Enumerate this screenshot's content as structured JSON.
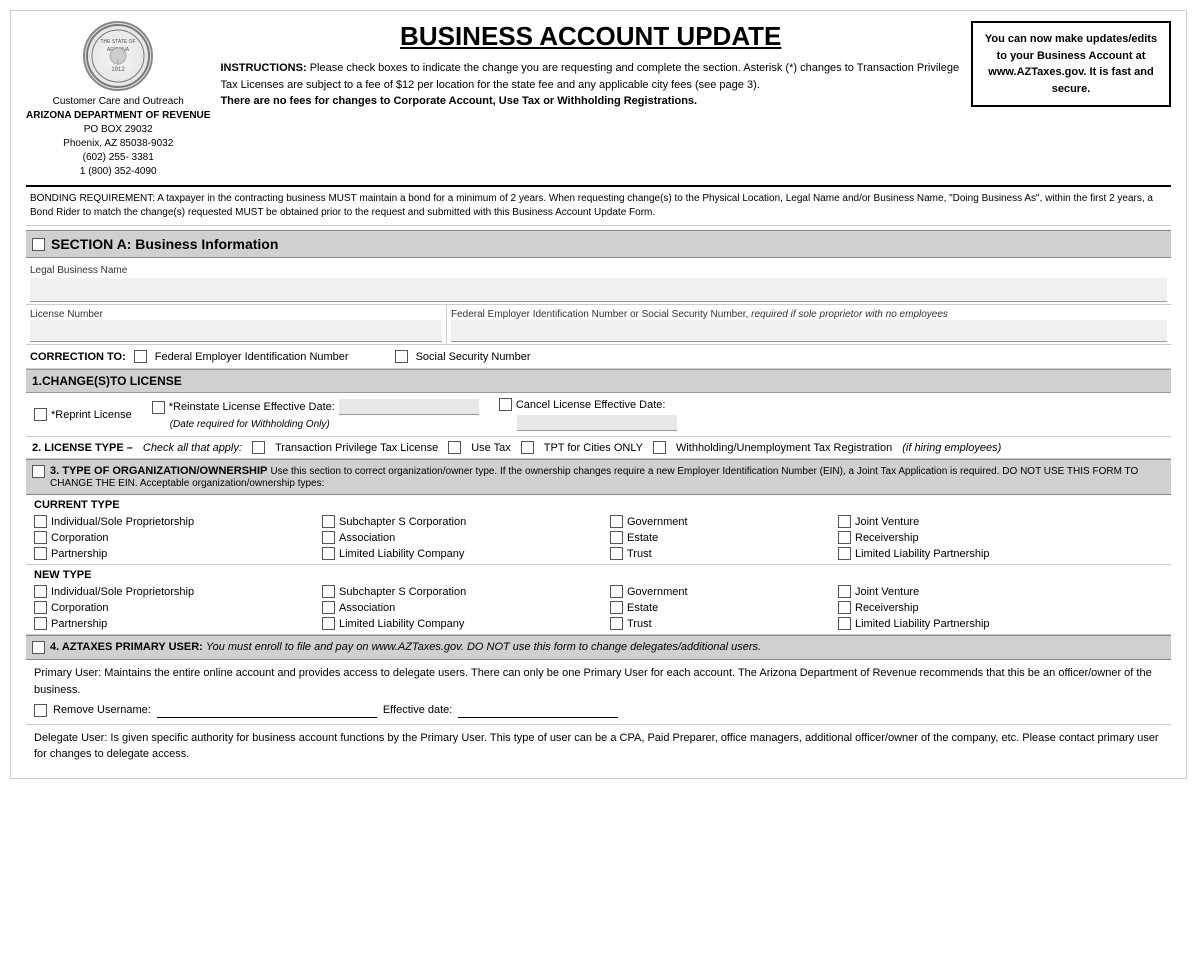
{
  "page": {
    "title": "BUSINESS ACCOUNT UPDATE",
    "seal_text": "THE STATE OF ARIZONA 1912",
    "dept": {
      "line1": "Customer Care and Outreach",
      "line2": "ARIZONA DEPARTMENT OF REVENUE",
      "line3": "PO BOX 29032",
      "line4": "Phoenix, AZ  85038-9032",
      "line5": "(602) 255- 3381",
      "line6": "1 (800) 352-4090"
    },
    "instructions": {
      "text1": "INSTRUCTIONS: ",
      "text2": "Please check boxes to indicate the change you are requesting and complete the section.  Asterisk (*) changes to Transaction Privilege Tax Licenses are subject to a fee of $12 per location for the state fee and any applicable city fees (see page 3).",
      "bold_text": "There are no fees for changes to Corporate Account, Use Tax or Withholding Registrations."
    },
    "sidebar": {
      "text": "You can now make updates/edits to your Business Account at www.AZTaxes.gov. It is fast and secure."
    },
    "bonding": {
      "text": "BONDING REQUIREMENT: A taxpayer in the contracting business MUST maintain a bond for a minimum of 2 years. When requesting change(s) to the Physical Location, Legal Name and/or Business Name, \"Doing Business As\",  within the first 2 years, a Bond Rider to match the change(s) requested MUST be obtained prior to the request and submitted with this Business Account Update Form."
    },
    "sectionA": {
      "title": "SECTION A:  Business Information",
      "legal_name_label": "Legal Business Name",
      "license_number_label": "License Number",
      "fein_label": "Federal Employer Identification Number or Social Security Number",
      "fein_note": "required if sole proprietor with no employees",
      "correction_label": "CORRECTION TO:",
      "correction_fein": "Federal Employer Identification Number",
      "correction_ssn": "Social Security Number"
    },
    "section1": {
      "title": "1.CHANGE(S)TO LICENSE",
      "reprint_label": "*Reprint License",
      "reinstate_label": "*Reinstate License Effective Date:",
      "cancel_label": "Cancel License Effective Date:",
      "date_required_note": "(Date required for Withholding Only)"
    },
    "section2": {
      "title": "2. LICENSE TYPE –",
      "subtitle": "Check all that apply:",
      "options": [
        "Transaction Privilege Tax License",
        "Use Tax",
        "TPT for Cities ONLY",
        "Withholding/Unemployment Tax Registration",
        "if hiring employees"
      ]
    },
    "section3": {
      "title": "3. TYPE OF ORGANIZATION/OWNERSHIP",
      "description": "Use this section to correct organization/owner type. If the ownership changes require a new Employer Identification Number (EIN), a Joint Tax Application is required. DO NOT USE THIS FORM TO CHANGE THE EIN. Acceptable organization/ownership types:",
      "current_type_label": "CURRENT TYPE",
      "new_type_label": "NEW TYPE",
      "org_types": {
        "col1": [
          "Individual/Sole Proprietorship",
          "Corporation",
          "Partnership"
        ],
        "col2": [
          "Subchapter S Corporation",
          "Association",
          "Limited Liability Company"
        ],
        "col3": [
          "Government",
          "Estate",
          "Trust"
        ],
        "col4": [
          "Joint Venture",
          "Receivership",
          "Limited Liability Partnership"
        ]
      }
    },
    "section4": {
      "title": "4. AZTAXES PRIMARY USER:",
      "description": "You must enroll to file and pay on www.AZTaxes.gov. DO NOT use this form to change delegates/additional users.",
      "primary_user_text": "Primary User: Maintains the entire online account and provides access to delegate users. There can only be one Primary User for each account. The Arizona Department of Revenue recommends that this be an officer/owner of the business.",
      "remove_username_label": "Remove Username:",
      "effective_date_label": "Effective date:",
      "delegate_text": "Delegate User: Is given specific authority for business account functions by the Primary User. This type of user can be a CPA, Paid Preparer, office managers, additional officer/owner of the company, etc. Please contact primary user for changes to delegate access."
    }
  }
}
